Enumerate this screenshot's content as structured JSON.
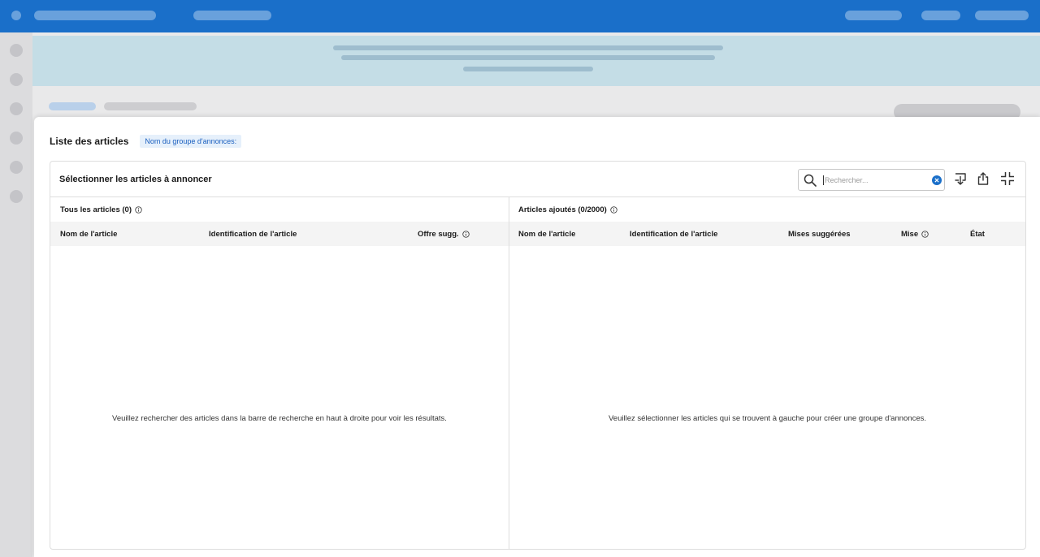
{
  "modal": {
    "title": "Liste des articles",
    "group_name_label": "Nom du groupe d'annonces:"
  },
  "panel": {
    "title": "Sélectionner les articles à annoncer",
    "search": {
      "placeholder": "Rechercher...",
      "value": ""
    },
    "tool_icons": [
      "download-icon",
      "export-icon",
      "collapse-icon"
    ]
  },
  "left_table": {
    "title": "Tous les articles (0)",
    "columns": [
      "Nom de l'article",
      "Identification de l'article",
      "Offre sugg."
    ],
    "empty_message": "Veuillez rechercher des articles dans la barre de recherche en haut à droite pour voir les résultats."
  },
  "right_table": {
    "title": "Articles ajoutés (0/2000)",
    "columns": [
      "Nom de l'article",
      "Identification de l'article",
      "Mises suggérées",
      "Mise",
      "État"
    ],
    "empty_message": "Veuillez sélectionner les articles qui se trouvent à gauche pour créer une groupe d'annonces."
  },
  "colors": {
    "topbar": "#1a6fc9",
    "accent": "#1a6fc9",
    "tag_background": "#e6f0fb",
    "tag_text": "#1a5fbf"
  }
}
